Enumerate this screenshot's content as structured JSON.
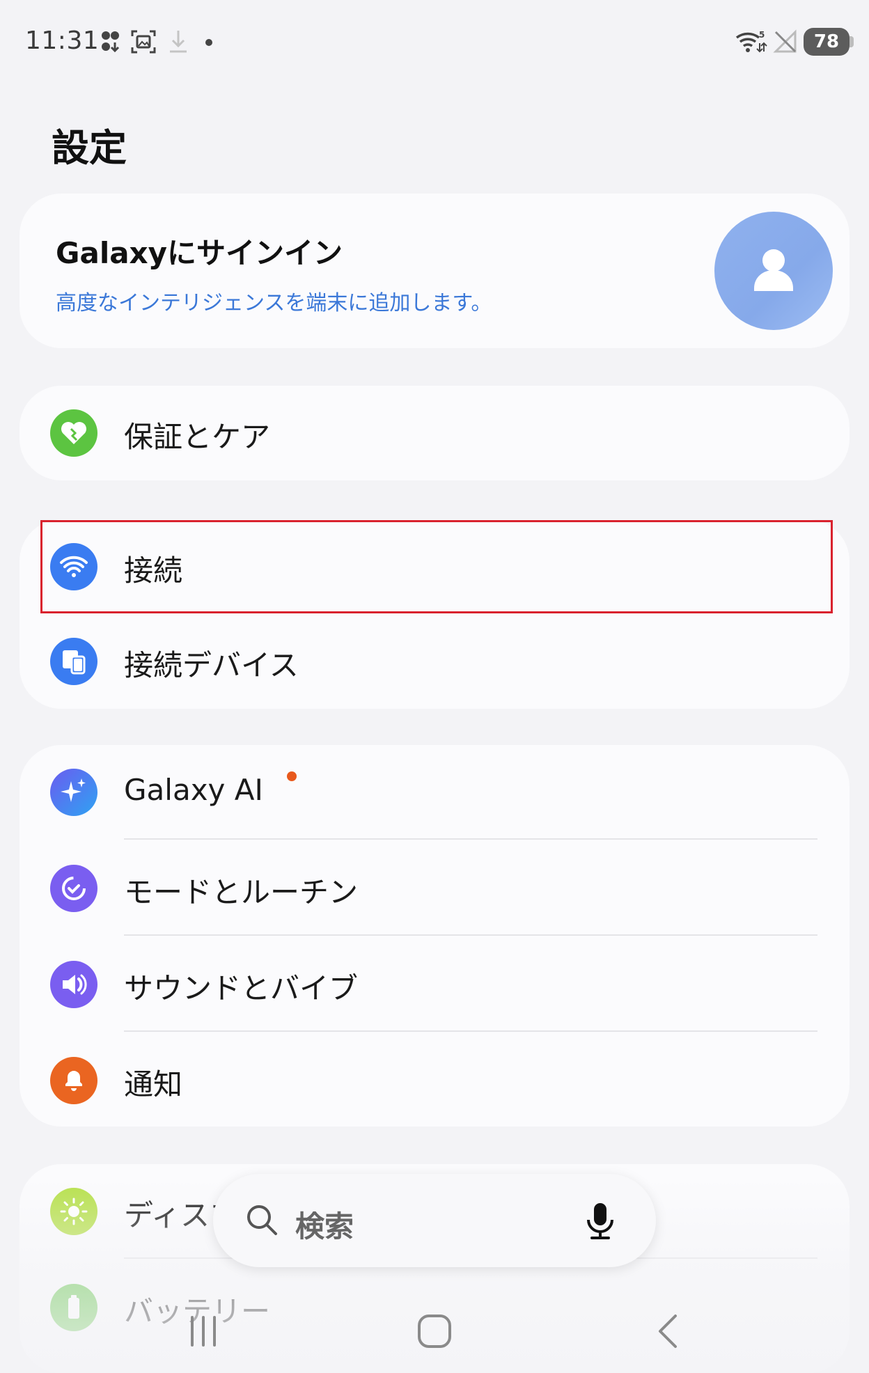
{
  "status_bar": {
    "time": "11:31",
    "network_type": "5",
    "battery": "78"
  },
  "page_title": "設定",
  "signin": {
    "title": "Galaxyにサインイン",
    "subtitle": "高度なインテリジェンスを端末に追加します。"
  },
  "groups": {
    "care": {
      "label": "保証とケア",
      "icon_color": "#5cc441"
    },
    "connections": {
      "label": "接続",
      "icon_color": "#3a7cf1"
    },
    "connected_devices": {
      "label": "接続デバイス",
      "icon_color": "#3a7cf1"
    },
    "galaxy_ai": {
      "label": "Galaxy AI",
      "icon_color": "#4e6ff2",
      "has_new_badge": true
    },
    "modes": {
      "label": "モードとルーチン",
      "icon_color": "#7a5ef0"
    },
    "sound": {
      "label": "サウンドとバイブ",
      "icon_color": "#7a5ef0"
    },
    "notifications": {
      "label": "通知",
      "icon_color": "#ea6521"
    },
    "display": {
      "label": "ディスプレイ",
      "icon_color": "#b6e04a"
    },
    "battery": {
      "label": "バッテリー",
      "icon_color": "#5cc441"
    }
  },
  "search": {
    "placeholder": "検索"
  },
  "highlight_color": "#d9222e"
}
